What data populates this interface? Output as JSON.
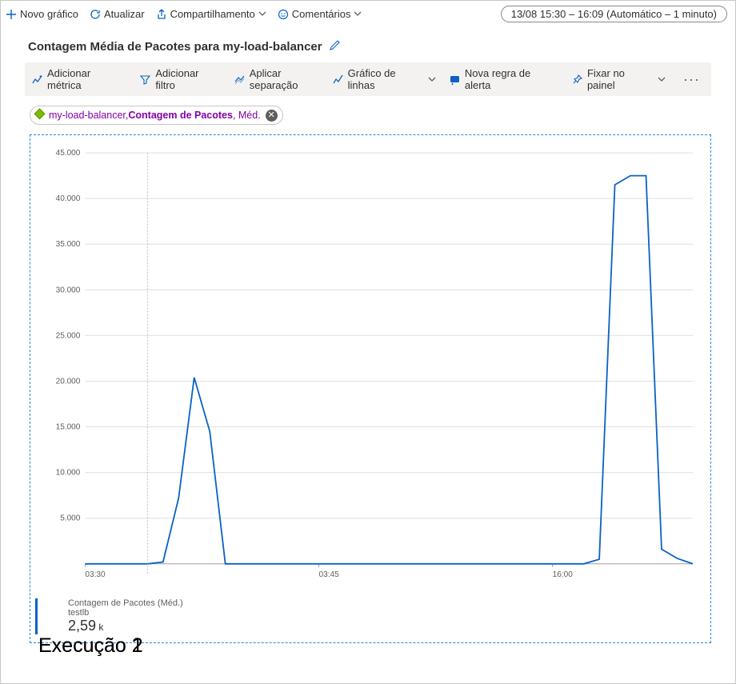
{
  "topbar": {
    "new_chart": "Novo gráfico",
    "refresh": "Atualizar",
    "share": "Compartilhamento",
    "comments": "Comentários",
    "time_range": "13/08 15:30 – 16:09 (Automático – 1 minuto)"
  },
  "title": "Contagem Média de Pacotes para my-load-balancer",
  "toolbar": {
    "add_metric": "Adicionar métrica",
    "add_filter": "Adicionar filtro",
    "apply_split": "Aplicar separação",
    "chart_type": "Gráfico de linhas",
    "new_alert": "Nova regra de alerta",
    "pin": "Fixar no painel"
  },
  "chip": {
    "resource": "my-load-balancer,",
    "metric": "Contagem de Pacotes",
    "agg": ", Méd."
  },
  "legend": {
    "line1": "Contagem de Pacotes (Méd.)",
    "line2": "testlb",
    "value": "2,59",
    "unit": " k"
  },
  "annotations": {
    "run1": "Execução 1",
    "run2": "Execução 2"
  },
  "chart_data": {
    "type": "line",
    "title": "Contagem Média de Pacotes para my-load-balancer",
    "xlabel": "",
    "ylabel": "",
    "ylim": [
      0,
      45000
    ],
    "y_ticks": [
      5000,
      10000,
      15000,
      20000,
      25000,
      30000,
      35000,
      40000,
      45000
    ],
    "y_tick_labels": [
      "5.000",
      "10.000",
      "15.000",
      "20.000",
      "25.000",
      "30.000",
      "35.000",
      "40.000",
      "45.000"
    ],
    "x_tick_labels": [
      "03:30",
      "03:45",
      "16:00"
    ],
    "x": [
      0,
      1,
      2,
      3,
      4,
      5,
      6,
      7,
      8,
      9,
      10,
      11,
      12,
      13,
      14,
      15,
      16,
      17,
      18,
      19,
      20,
      21,
      22,
      23,
      24,
      25,
      26,
      27,
      28,
      29,
      30,
      31,
      32,
      33,
      34,
      35,
      36,
      37,
      38,
      39
    ],
    "values": [
      0,
      0,
      0,
      0,
      0,
      200,
      7200,
      20400,
      14500,
      0,
      0,
      0,
      0,
      0,
      0,
      0,
      0,
      0,
      0,
      0,
      0,
      0,
      0,
      0,
      0,
      0,
      0,
      0,
      0,
      0,
      0,
      0,
      0,
      500,
      41500,
      42500,
      42500,
      1600,
      600,
      0
    ],
    "annotations": [
      {
        "text": "Execução 1",
        "x": 7,
        "y": 23000
      },
      {
        "text": "Execução 2",
        "x": 35,
        "y": 45000
      }
    ],
    "series": [
      {
        "name": "Contagem de Pacotes (Méd.) – testlb",
        "color": "#0b62c4"
      }
    ]
  }
}
